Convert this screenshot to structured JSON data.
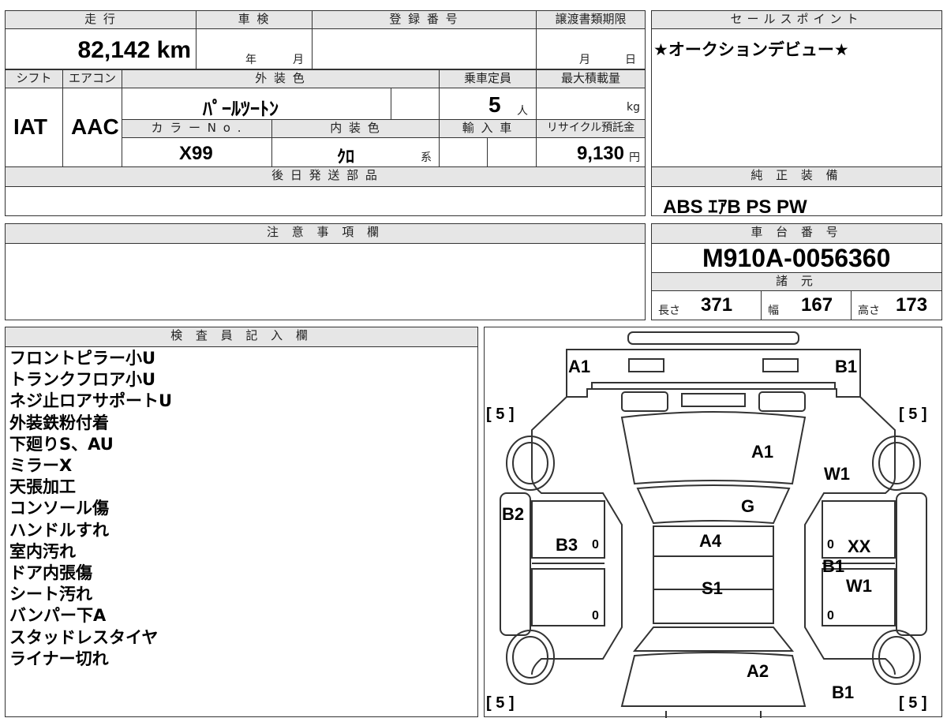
{
  "header": {
    "mileage_label": "走 行",
    "inspection_label": "車 検",
    "registration_label": "登 録 番 号",
    "transfer_deadline_label": "譲渡書類期限",
    "sales_point_label": "セールスポイント",
    "shift_label": "シフト",
    "aircon_label": "エアコン",
    "exterior_color_label": "外 装 色",
    "capacity_label": "乗車定員",
    "max_load_label": "最大積載量",
    "color_no_label": "カ ラ ー N o .",
    "interior_color_label": "内 装 色",
    "import_label": "輸 入 車",
    "recycle_label": "リサイクル預託金",
    "later_parts_label": "後 日 発 送 部 品",
    "standard_equipment_label": "純 正 装 備",
    "caution_label": "注 意 事 項 欄",
    "chassis_label": "車 台 番 号",
    "specs_label": "諸 元",
    "inspector_label": "検 査 員 記 入 欄"
  },
  "vehicle": {
    "mileage": "82,142 km",
    "inspection_year_unit": "年",
    "inspection_month_unit": "月",
    "transfer_month_unit": "月",
    "transfer_day_unit": "日",
    "shift": "IAT",
    "aircon": "AAC",
    "exterior_color": "ﾊﾟｰﾙﾂｰﾄﾝ",
    "capacity": "5",
    "capacity_unit": "人",
    "max_load_unit": "kg",
    "color_no": "X99",
    "interior_color": "ｸﾛ",
    "interior_color_suffix": "系",
    "recycle_fee": "9,130",
    "recycle_unit": "円",
    "sales_point": "★オークションデビュー★",
    "standard_equipment": "ABS ｴｱB PS PW",
    "chassis_no": "M910A-0056360",
    "length_label": "長さ",
    "length": "371",
    "width_label": "幅",
    "width": "167",
    "height_label": "高さ",
    "height": "173"
  },
  "inspector_notes": [
    "フロントピラー小U",
    "トランクフロア小U",
    "ネジ止ロアサポートU",
    "外装鉄粉付着",
    "下廻りS、AU",
    "ミラーX",
    "天張加工",
    "コンソール傷",
    "ハンドルすれ",
    "室内汚れ",
    "ドア内張傷",
    "シート汚れ",
    "バンパー下A",
    "スタッドレスタイヤ",
    "ライナー切れ"
  ],
  "diagram": {
    "tread_left_top": "[ 5 ]",
    "tread_right_top": "[ 5 ]",
    "tread_left_bottom": "[ 5 ]",
    "tread_right_bottom": "[ 5 ]",
    "front_left": "A1",
    "front_right": "B1",
    "hood": "A1",
    "fender_right": "W1",
    "windshield": "G",
    "fender_left": "B2",
    "left_front_door": "B3",
    "roof": "A4",
    "right_front_door": "XX",
    "right_door_b": "B1",
    "right_rear_door": "W1",
    "roof_rear": "S1",
    "rear_hatch": "A2",
    "rear_right": "B1",
    "door_zero": "0"
  }
}
